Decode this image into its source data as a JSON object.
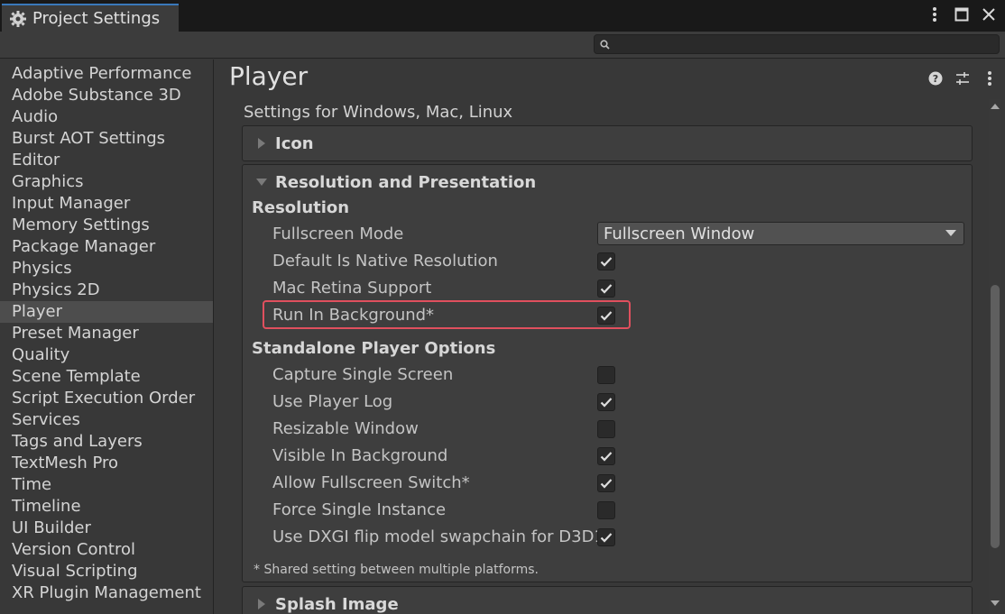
{
  "window": {
    "tab_title": "Project Settings",
    "icons": [
      "gear-icon",
      "more-vert-icon",
      "maximize-icon",
      "close-icon"
    ]
  },
  "search": {
    "placeholder": "",
    "value": "",
    "icon": "search-icon"
  },
  "sidebar": {
    "selected": "Player",
    "items": [
      {
        "label": "Adaptive Performance"
      },
      {
        "label": "Adobe Substance 3D"
      },
      {
        "label": "Audio"
      },
      {
        "label": "Burst AOT Settings"
      },
      {
        "label": "Editor"
      },
      {
        "label": "Graphics"
      },
      {
        "label": "Input Manager"
      },
      {
        "label": "Memory Settings"
      },
      {
        "label": "Package Manager"
      },
      {
        "label": "Physics"
      },
      {
        "label": "Physics 2D"
      },
      {
        "label": "Player"
      },
      {
        "label": "Preset Manager"
      },
      {
        "label": "Quality"
      },
      {
        "label": "Scene Template"
      },
      {
        "label": "Script Execution Order"
      },
      {
        "label": "Services"
      },
      {
        "label": "Tags and Layers"
      },
      {
        "label": "TextMesh Pro"
      },
      {
        "label": "Time"
      },
      {
        "label": "Timeline"
      },
      {
        "label": "UI Builder"
      },
      {
        "label": "Version Control"
      },
      {
        "label": "Visual Scripting"
      },
      {
        "label": "XR Plugin Management"
      }
    ]
  },
  "main": {
    "title": "Player",
    "settings_for": "Settings for Windows, Mac, Linux",
    "foldouts": {
      "icon": {
        "label": "Icon",
        "expanded": false
      },
      "resolution": {
        "label": "Resolution and Presentation",
        "expanded": true
      },
      "splash": {
        "label": "Splash Image",
        "expanded": false
      }
    },
    "resolution_section": {
      "label": "Resolution",
      "fullscreen_mode": {
        "label": "Fullscreen Mode",
        "value": "Fullscreen Window"
      },
      "default_native": {
        "label": "Default Is Native Resolution",
        "checked": true
      },
      "mac_retina": {
        "label": "Mac Retina Support",
        "checked": true
      },
      "run_in_background": {
        "label": "Run In Background*",
        "checked": true
      }
    },
    "standalone_section": {
      "label": "Standalone Player Options",
      "capture_single_screen": {
        "label": "Capture Single Screen",
        "checked": false
      },
      "use_player_log": {
        "label": "Use Player Log",
        "checked": true
      },
      "resizable_window": {
        "label": "Resizable Window",
        "checked": false
      },
      "visible_in_background": {
        "label": "Visible In Background",
        "checked": true
      },
      "allow_fullscreen_switch": {
        "label": "Allow Fullscreen Switch*",
        "checked": true
      },
      "force_single_instance": {
        "label": "Force Single Instance",
        "checked": false
      },
      "use_dxgi_flip": {
        "label": "Use DXGI flip model swapchain for D3D1",
        "checked": true
      }
    },
    "footnote": "* Shared setting between multiple platforms."
  },
  "colors": {
    "highlight": "#e0505e",
    "accent_tab": "#3a79bb",
    "panel_bg": "#383838",
    "selected_item": "#4d4d4d"
  }
}
